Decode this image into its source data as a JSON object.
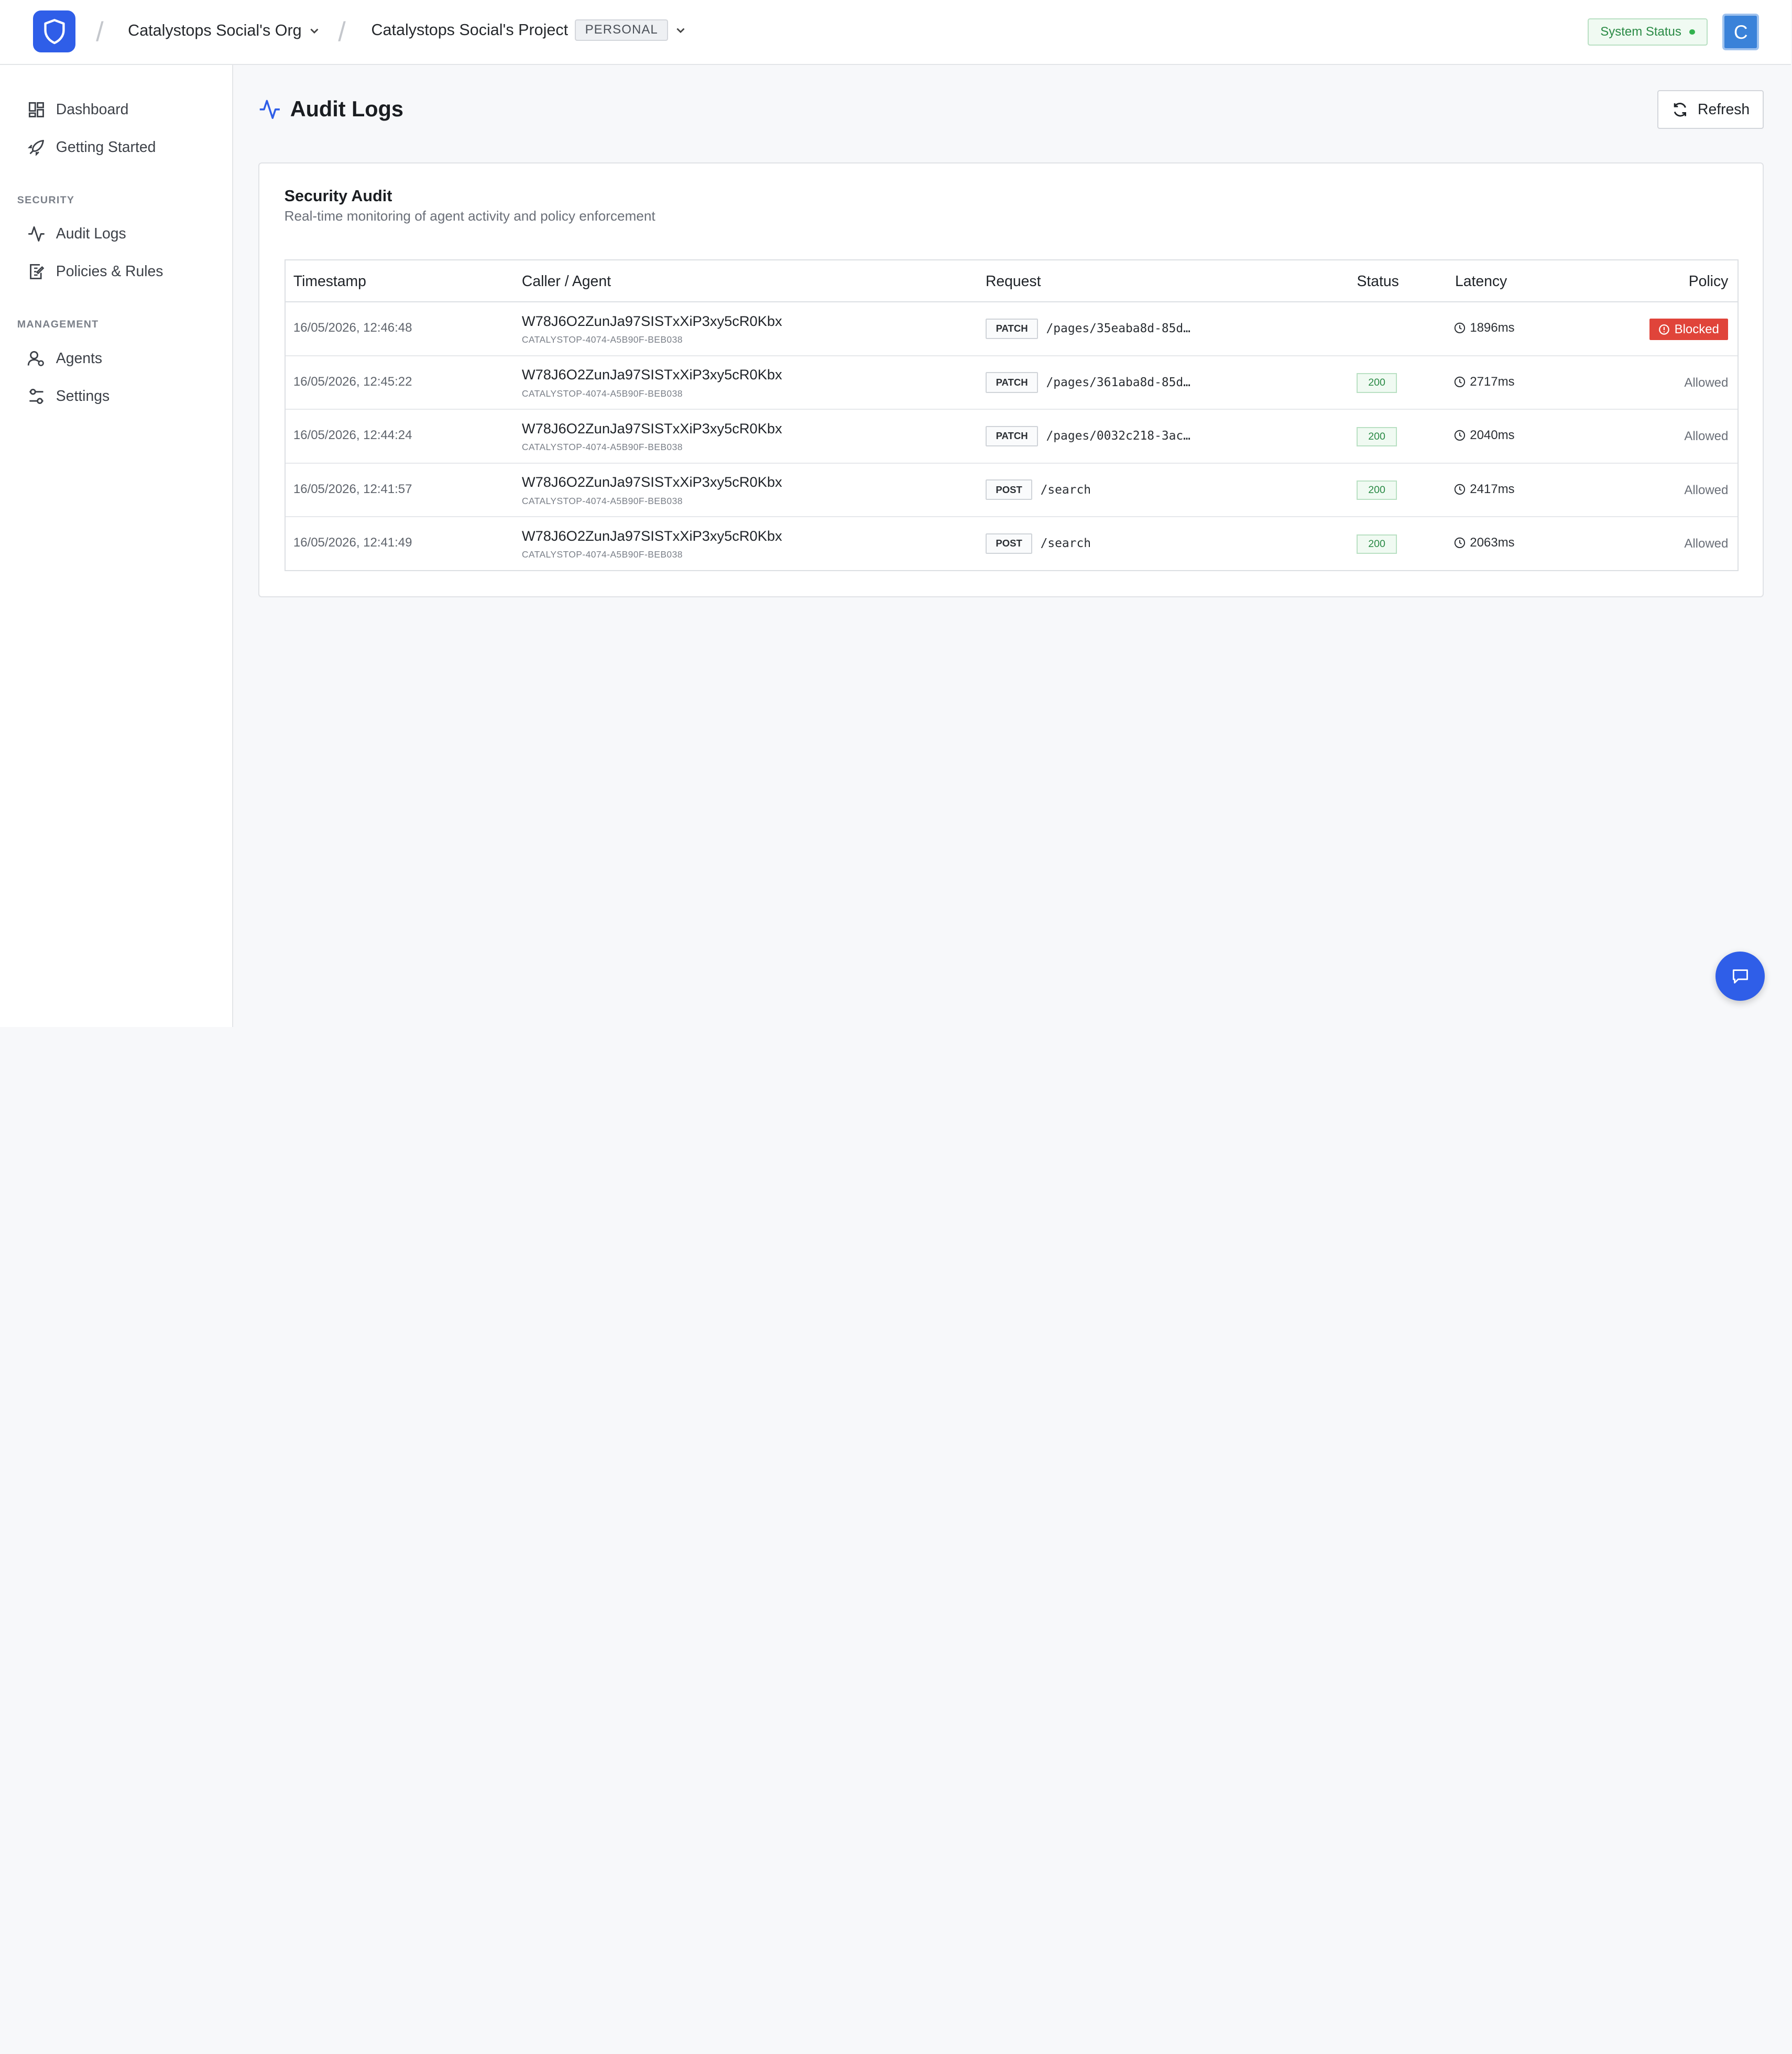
{
  "header": {
    "org_name": "Catalystops Social's Org",
    "project_name": "Catalystops Social's Project",
    "project_badge": "PERSONAL",
    "system_status": "System Status",
    "avatar_initial": "C"
  },
  "sidebar": {
    "items_top": [
      {
        "label": "Dashboard",
        "icon": "dashboard-icon"
      },
      {
        "label": "Getting Started",
        "icon": "rocket-icon"
      }
    ],
    "section_security": "SECURITY",
    "items_security": [
      {
        "label": "Audit Logs",
        "icon": "activity-icon"
      },
      {
        "label": "Policies & Rules",
        "icon": "policy-icon"
      }
    ],
    "section_management": "MANAGEMENT",
    "items_management": [
      {
        "label": "Agents",
        "icon": "agents-icon"
      },
      {
        "label": "Settings",
        "icon": "settings-icon"
      }
    ]
  },
  "main": {
    "page_title": "Audit Logs",
    "refresh_label": "Refresh",
    "card_title": "Security Audit",
    "card_subtitle": "Real-time monitoring of agent activity and policy enforcement",
    "columns": [
      "Timestamp",
      "Caller / Agent",
      "Request",
      "Status",
      "Latency",
      "Policy"
    ],
    "rows": [
      {
        "timestamp": "16/05/2026, 12:46:48",
        "caller": "W78J6O2ZunJa97SISTxXiP3xy5cR0Kbx",
        "caller_id": "CATALYSTOP-4074-A5B90F-BEB038",
        "method": "PATCH",
        "path": "/pages/35eaba8d-85d…",
        "status": "",
        "latency": "1896ms",
        "policy": "Blocked"
      },
      {
        "timestamp": "16/05/2026, 12:45:22",
        "caller": "W78J6O2ZunJa97SISTxXiP3xy5cR0Kbx",
        "caller_id": "CATALYSTOP-4074-A5B90F-BEB038",
        "method": "PATCH",
        "path": "/pages/361aba8d-85d…",
        "status": "200",
        "latency": "2717ms",
        "policy": "Allowed"
      },
      {
        "timestamp": "16/05/2026, 12:44:24",
        "caller": "W78J6O2ZunJa97SISTxXiP3xy5cR0Kbx",
        "caller_id": "CATALYSTOP-4074-A5B90F-BEB038",
        "method": "PATCH",
        "path": "/pages/0032c218-3ac…",
        "status": "200",
        "latency": "2040ms",
        "policy": "Allowed"
      },
      {
        "timestamp": "16/05/2026, 12:41:57",
        "caller": "W78J6O2ZunJa97SISTxXiP3xy5cR0Kbx",
        "caller_id": "CATALYSTOP-4074-A5B90F-BEB038",
        "method": "POST",
        "path": "/search",
        "status": "200",
        "latency": "2417ms",
        "policy": "Allowed"
      },
      {
        "timestamp": "16/05/2026, 12:41:49",
        "caller": "W78J6O2ZunJa97SISTxXiP3xy5cR0Kbx",
        "caller_id": "CATALYSTOP-4074-A5B90F-BEB038",
        "method": "POST",
        "path": "/search",
        "status": "200",
        "latency": "2063ms",
        "policy": "Allowed"
      }
    ]
  },
  "colors": {
    "brand": "#2f5ee8",
    "success": "#2a8a45",
    "danger": "#e0443a"
  }
}
